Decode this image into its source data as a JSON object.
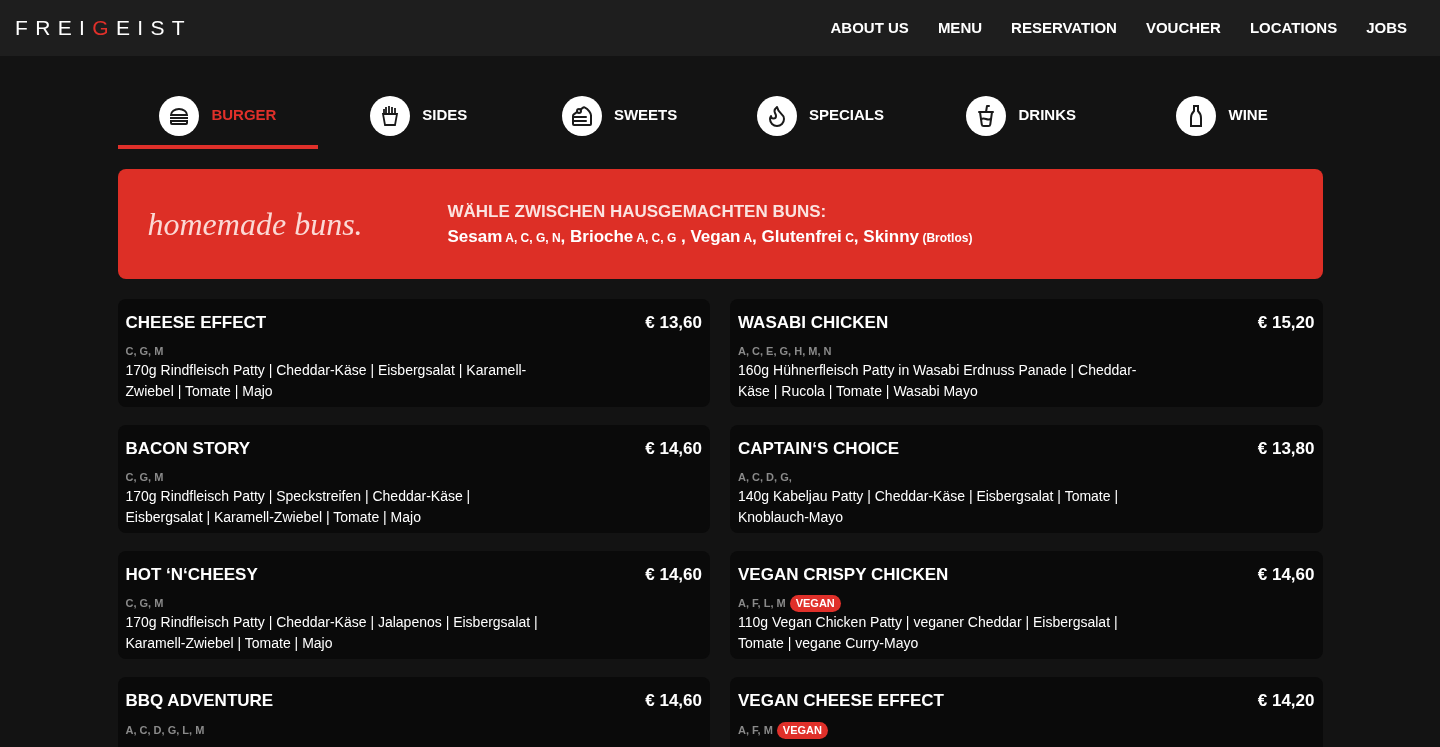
{
  "logo": "FREI**G**EIST",
  "nav": [
    "ABOUT US",
    "MENU",
    "RESERVATION",
    "VOUCHER",
    "LOCATIONS",
    "JOBS"
  ],
  "tabs": [
    {
      "label": "BURGER",
      "kind": "burger",
      "selected": true
    },
    {
      "label": "SIDES",
      "kind": "fries",
      "selected": false
    },
    {
      "label": "SWEETS",
      "kind": "cake",
      "selected": false
    },
    {
      "label": "SPECIALS",
      "kind": "flame",
      "selected": false
    },
    {
      "label": "DRINKS",
      "kind": "cup",
      "selected": false
    },
    {
      "label": "WINE",
      "kind": "bottle",
      "selected": false
    }
  ],
  "banner": {
    "script": "homemade buns.",
    "heading": "WÄHLE ZWISCHEN HAUSGEMACHTEN BUNS:",
    "buns": [
      {
        "name": "Sesam",
        "allergens": "A, C, G, N",
        "suffix": ","
      },
      {
        "name": "Brioche",
        "allergens": "A, C, G",
        "suffix": " ,"
      },
      {
        "name": "Vegan",
        "allergens": "A",
        "suffix": ","
      },
      {
        "name": "Glutenfrei",
        "allergens": "C",
        "suffix": ","
      },
      {
        "name": "Skinny",
        "note": "(Brotlos)"
      }
    ]
  },
  "items": [
    {
      "name": "CHEESE EFFECT",
      "price": "€ 13,60",
      "allergens": "C, G, M",
      "description": "170g Rindfleisch Patty | Cheddar-Käse | Eisbergsalat | Karamell-Zwiebel | Tomate | Majo"
    },
    {
      "name": "WASABI CHICKEN",
      "price": "€ 15,20",
      "allergens": "A, C, E, G, H, M, N",
      "description": "160g Hühnerfleisch Patty in Wasabi Erdnuss Panade | Cheddar-Käse | Rucola | Tomate | Wasabi Mayo"
    },
    {
      "name": "BACON STORY",
      "price": "€ 14,60",
      "allergens": "C, G, M",
      "description": "170g Rindfleisch Patty | Speckstreifen | Cheddar-Käse | Eisbergsalat | Karamell-Zwiebel | Tomate | Majo"
    },
    {
      "name": "CAPTAIN‘S CHOICE",
      "price": "€ 13,80",
      "allergens": "A, C, D, G,",
      "description": "140g Kabeljau Patty | Cheddar-Käse | Eisbergsalat | Tomate | Knoblauch-Mayo"
    },
    {
      "name": "HOT ‘N‘CHEESY",
      "price": "€ 14,60",
      "allergens": "C, G, M",
      "description": "170g Rindfleisch Patty | Cheddar-Käse | Jalapenos | Eisbergsalat | Karamell-Zwiebel | Tomate | Majo"
    },
    {
      "name": "VEGAN CRISPY CHICKEN",
      "price": "€ 14,60",
      "allergens": "A, F, L, M",
      "tag": "VEGAN",
      "description": "110g Vegan Chicken Patty | veganer Cheddar | Eisbergsalat | Tomate | vegane Curry-Mayo"
    },
    {
      "name": "BBQ ADVENTURE",
      "price": "€ 14,60",
      "allergens": "A, C, D, G, L, M"
    },
    {
      "name": "VEGAN CHEESE EFFECT",
      "price": "€ 14,20",
      "allergens": "A, F, M",
      "tag": "VEGAN"
    }
  ]
}
